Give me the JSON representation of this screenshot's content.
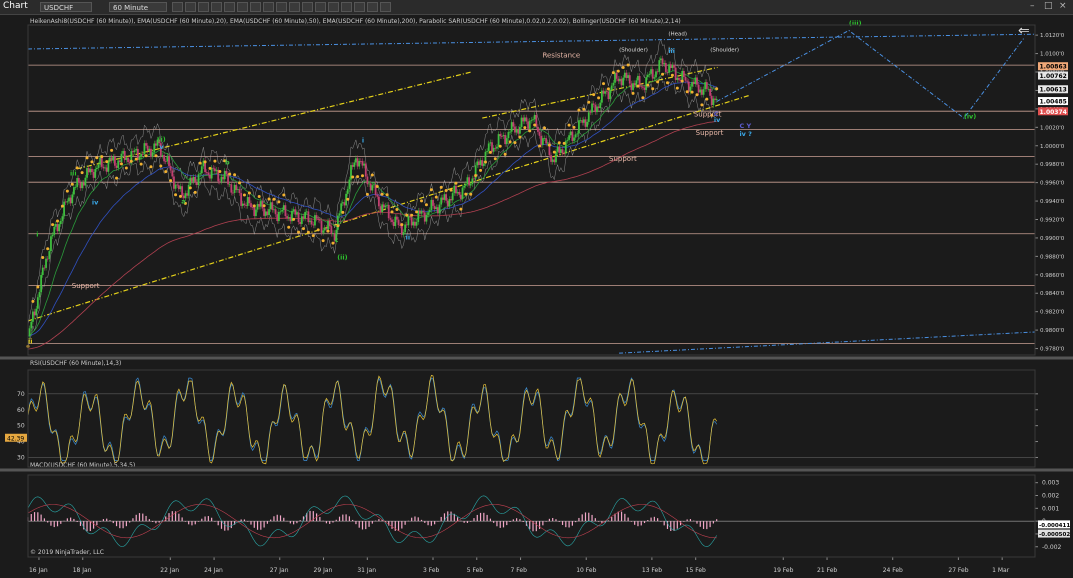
{
  "window": {
    "title": "Chart",
    "instrument": "USDCHF",
    "timeframe": "60 Minute",
    "controls": [
      "–",
      "□",
      "×"
    ]
  },
  "colors": {
    "background": "#1b1b1b",
    "candle_up": "#3fbf3f",
    "candle_down": "#c04070",
    "sar": "#f0b030",
    "trendline": "#e6d21a",
    "level": "#e8b8a8",
    "projection": "#4a90e2",
    "wave_green": "#2ec22e",
    "wave_cyan": "#3aa8e8",
    "rsi_line": "#e6c23a",
    "macd_hist": "#f2a8c8"
  },
  "price_panel": {
    "header": "HeikenAshi8(USDCHF (60 Minute)), EMA(USDCHF (60 Minute),20), EMA(USDCHF (60 Minute),50), EMA(USDCHF (60 Minute),200), Parabolic SAR(USDCHF (60 Minute),0.02,0.2,0.02), Bollinger(USDCHF (60 Minute),2,14)",
    "axis_ticks": [
      "1.0120'0",
      "1.0100'0",
      "1.0080'0",
      "1.0060'0",
      "1.0040'0",
      "1.0020'0",
      "1.0000'0",
      "0.9980'0",
      "0.9960'0",
      "0.9940'0",
      "0.9920'0",
      "0.9900'0",
      "0.9880'0",
      "0.9860'0",
      "0.9840'0",
      "0.9820'0",
      "0.9800'0",
      "0.9780'0"
    ],
    "price_badges": [
      {
        "text": "1.00863",
        "bg": "#f0a878",
        "fg": "#000"
      },
      {
        "text": "1.00762",
        "bg": "#e6e6e6",
        "fg": "#000"
      },
      {
        "text": "1.00613",
        "bg": "#e6e6e6",
        "fg": "#000"
      },
      {
        "text": "1.00485",
        "bg": "#ffffff",
        "fg": "#000"
      },
      {
        "text": "1.00374",
        "bg": "#e05050",
        "fg": "#fff"
      }
    ],
    "levels": [
      1.00875,
      1.00375,
      1.00175,
      0.99885,
      0.99605,
      0.99045,
      0.98485,
      0.97855
    ],
    "annotations": [
      {
        "text": "Resistance",
        "x": "2019-02-08T00:00",
        "y": 1.00955,
        "color": "#e8b8a8"
      },
      {
        "text": "Support",
        "x": "2019-01-17T12:00",
        "y": 0.98455,
        "color": "#e8b8a8"
      },
      {
        "text": "Support",
        "x": "2019-02-11T01:00",
        "y": 0.99835,
        "color": "#e8b8a8"
      },
      {
        "text": "Support",
        "x": "2019-02-14T22:00",
        "y": 1.00315,
        "color": "#e8b8a8"
      },
      {
        "text": "Support",
        "x": "2019-02-15T00:00",
        "y": 1.00115,
        "color": "#e8b8a8"
      },
      {
        "text": "(Shoulder)",
        "x": "2019-02-11T12:00",
        "y": 1.01025,
        "color": "#dddddd"
      },
      {
        "text": "(Head)",
        "x": "2019-02-13T18:00",
        "y": 1.01195,
        "color": "#dddddd"
      },
      {
        "text": "(Shoulder)",
        "x": "2019-02-15T16:00",
        "y": 1.01025,
        "color": "#dddddd"
      }
    ],
    "waves": [
      {
        "text": "i",
        "x": "2019-01-15T21:00",
        "y": 0.99015,
        "color": "#2ec22e"
      },
      {
        "text": "ii",
        "x": "2019-01-15T12:00",
        "y": 0.97855,
        "color": "#e6d21a"
      },
      {
        "text": "iii",
        "x": "2019-01-17T10:00",
        "y": 0.99675,
        "color": "#2ec22e"
      },
      {
        "text": "(i)",
        "x": "2019-01-21T10:00",
        "y": 1.00045,
        "color": "#2ec22e"
      },
      {
        "text": "(ii)",
        "x": "2019-01-29T15:00",
        "y": 0.98765,
        "color": "#2ec22e"
      },
      {
        "text": "(iii)",
        "x": "2019-02-22T00:00",
        "y": 1.01305,
        "color": "#2ec22e"
      },
      {
        "text": "(iv)",
        "x": "2019-02-27T06:00",
        "y": 1.00295,
        "color": "#2ec22e"
      },
      {
        "text": "iv",
        "x": "2019-01-18T10:00",
        "y": 0.99365,
        "color": "#3aa8e8"
      },
      {
        "text": "v",
        "x": "2019-01-21T12:00",
        "y": 0.99965,
        "color": "#3aa8e8"
      },
      {
        "text": "i",
        "x": "2019-01-30T18:00",
        "y": 1.00035,
        "color": "#3aa8e8"
      },
      {
        "text": "ii",
        "x": "2019-02-01T18:00",
        "y": 0.98985,
        "color": "#3aa8e8"
      },
      {
        "text": "iii",
        "x": "2019-02-13T18:00",
        "y": 1.01005,
        "color": "#3aa8e8"
      },
      {
        "text": "iv",
        "x": "2019-02-15T20:00",
        "y": 1.00255,
        "color": "#3aa8e8"
      },
      {
        "text": "iv ?",
        "x": "2019-02-17T00:00",
        "y": 1.00105,
        "color": "#3aa8e8"
      },
      {
        "text": "a",
        "x": "2019-01-22T12:00",
        "y": 0.99375,
        "color": "#3fbf3f"
      },
      {
        "text": "b",
        "x": "2019-01-24T12:00",
        "y": 0.99795,
        "color": "#3fbf3f"
      },
      {
        "text": "c",
        "x": "2019-01-29T12:00",
        "y": 0.98955,
        "color": "#3fbf3f"
      },
      {
        "text": "C",
        "x": "2019-02-15T20:00",
        "y": 1.00325,
        "color": "#5c5cd0"
      },
      {
        "text": "C Y",
        "x": "2019-02-17T00:00",
        "y": 1.00195,
        "color": "#5c5cd0"
      }
    ],
    "last_price": 1.00485,
    "ylim": [
      0.9773,
      1.0131
    ]
  },
  "rsi_panel": {
    "header": "RSI(USDCHF (60 Minute),14,3)",
    "ticks": [
      "70",
      "60",
      "50",
      "40",
      "30"
    ],
    "current": "42.39",
    "levels": [
      70,
      30
    ],
    "ylim": [
      24,
      85
    ]
  },
  "macd_panel": {
    "header": "MACD(USDCHF (60 Minute),5,34,5)",
    "ticks": [
      "0.003",
      "0.002",
      "0.001",
      "0",
      "-0.001",
      "-0.002"
    ],
    "badges": [
      {
        "text": "-0.000411",
        "bg": "#ffffff",
        "fg": "#000"
      },
      {
        "text": "-0.000502",
        "bg": "#e0e0e0",
        "fg": "#000"
      }
    ],
    "ylim": [
      -0.0028,
      0.0036
    ]
  },
  "copyright": "© 2019 NinjaTrader, LLC",
  "x_axis": {
    "labels": [
      {
        "text": "16 Jan",
        "x": "2019-01-16T00:00"
      },
      {
        "text": "18 Jan",
        "x": "2019-01-18T00:00"
      },
      {
        "text": "22 Jan",
        "x": "2019-01-22T00:00"
      },
      {
        "text": "24 Jan",
        "x": "2019-01-24T00:00"
      },
      {
        "text": "27 Jan",
        "x": "2019-01-27T00:00"
      },
      {
        "text": "29 Jan",
        "x": "2019-01-29T00:00"
      },
      {
        "text": "31 Jan",
        "x": "2019-01-31T00:00"
      },
      {
        "text": "3 Feb",
        "x": "2019-02-03T00:00"
      },
      {
        "text": "5 Feb",
        "x": "2019-02-05T00:00"
      },
      {
        "text": "7 Feb",
        "x": "2019-02-07T00:00"
      },
      {
        "text": "10 Feb",
        "x": "2019-02-10T00:00"
      },
      {
        "text": "13 Feb",
        "x": "2019-02-13T00:00"
      },
      {
        "text": "15 Feb",
        "x": "2019-02-15T00:00"
      },
      {
        "text": "19 Feb",
        "x": "2019-02-19T00:00"
      },
      {
        "text": "21 Feb",
        "x": "2019-02-21T00:00"
      },
      {
        "text": "24 Feb",
        "x": "2019-02-24T00:00"
      },
      {
        "text": "27 Feb",
        "x": "2019-02-27T00:00"
      },
      {
        "text": "1 Mar",
        "x": "2019-03-01T00:00"
      }
    ]
  },
  "chart_data": {
    "type": "line",
    "instrument": "USDCHF",
    "timeframe": "60 Minute",
    "x": [
      "2019-01-15T12:00",
      "2019-01-16T12:00",
      "2019-01-17T12:00",
      "2019-01-18T12:00",
      "2019-01-21T12:00",
      "2019-01-22T12:00",
      "2019-01-23T12:00",
      "2019-01-24T12:00",
      "2019-01-25T12:00",
      "2019-01-28T12:00",
      "2019-01-29T12:00",
      "2019-01-30T12:00",
      "2019-01-31T12:00",
      "2019-02-01T12:00",
      "2019-02-04T12:00",
      "2019-02-05T12:00",
      "2019-02-06T12:00",
      "2019-02-07T12:00",
      "2019-02-08T12:00",
      "2019-02-11T12:00",
      "2019-02-12T12:00",
      "2019-02-13T12:00",
      "2019-02-14T12:00",
      "2019-02-15T12:00",
      "2019-02-15T23:00"
    ],
    "series": [
      {
        "values": [
          0.979,
          0.9895,
          0.995,
          0.9975,
          1.0,
          0.9945,
          0.9975,
          0.9965,
          0.9935,
          0.992,
          0.9905,
          0.999,
          0.994,
          0.991,
          0.9955,
          0.9995,
          1.0015,
          1.003,
          0.9985,
          1.0075,
          1.0065,
          1.009,
          1.007,
          1.006,
          1.0048
        ]
      }
    ],
    "projection": [
      {
        "x": "2019-02-15T23:00",
        "y": 1.0048
      },
      {
        "x": "2019-02-22T00:00",
        "y": 1.0125
      },
      {
        "x": "2019-02-27T06:00",
        "y": 1.003
      },
      {
        "x": "2019-03-02T00:00",
        "y": 1.0117
      }
    ],
    "trend_channel": {
      "lower": [
        {
          "x": "2019-01-15T12:00",
          "y": 0.981
        },
        {
          "x": "2019-02-17T12:00",
          "y": 1.0055
        }
      ],
      "upper": [
        {
          "x": "2019-01-17T18:00",
          "y": 0.9975
        },
        {
          "x": "2019-02-04T18:00",
          "y": 1.008
        }
      ],
      "mid": [
        {
          "x": "2019-02-05T06:00",
          "y": 1.003
        },
        {
          "x": "2019-02-16T00:00",
          "y": 1.0085
        }
      ]
    },
    "xlim": [
      "2019-01-15T12:00",
      "2019-03-02T12:00"
    ]
  }
}
